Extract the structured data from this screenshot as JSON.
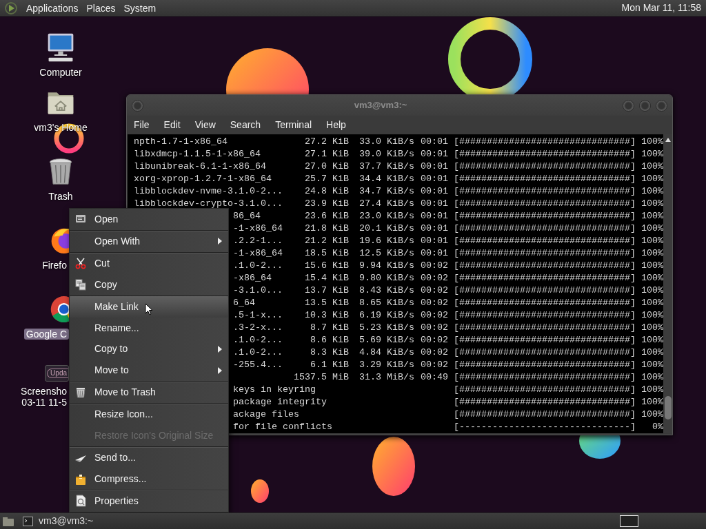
{
  "top_panel": {
    "menus": [
      "Applications",
      "Places",
      "System"
    ],
    "clock": "Mon Mar 11, 11:58"
  },
  "desktop_icons": [
    {
      "kind": "computer",
      "lines": [
        "Computer"
      ],
      "selected": false,
      "covered": false
    },
    {
      "kind": "home",
      "lines": [
        "vm3's Home"
      ],
      "selected": false,
      "covered": false
    },
    {
      "kind": "trash",
      "lines": [
        "Trash"
      ],
      "selected": false,
      "covered": false
    },
    {
      "kind": "firefox",
      "lines": [
        "Firefo"
      ],
      "selected": false,
      "covered": true
    },
    {
      "kind": "chrome",
      "lines": [
        "Google C"
      ],
      "selected": true,
      "covered": true
    },
    {
      "kind": "thumbnail",
      "thumb_text": "Upda",
      "lines": [
        "Screensho",
        "03-11 11-5"
      ],
      "selected": false,
      "covered": true
    }
  ],
  "terminal": {
    "title": "vm3@vm3:~",
    "menus": [
      "File",
      "Edit",
      "View",
      "Search",
      "Terminal",
      "Help"
    ],
    "rows": [
      {
        "name": "npth-1.7-1-x86_64",
        "covered": false,
        "size": "27.2 KiB",
        "speed": "33.0 KiB/s",
        "time": "00:01",
        "bar": "[###############################]",
        "percent": "100%"
      },
      {
        "name": "libxdmcp-1.1.5-1-x86_64",
        "covered": false,
        "size": "27.1 KiB",
        "speed": "39.0 KiB/s",
        "time": "00:01",
        "bar": "[###############################]",
        "percent": "100%"
      },
      {
        "name": "libunibreak-6.1-1-x86_64",
        "covered": false,
        "size": "27.0 KiB",
        "speed": "37.7 KiB/s",
        "time": "00:01",
        "bar": "[###############################]",
        "percent": "100%"
      },
      {
        "name": "xorg-xprop-1.2.7-1-x86_64",
        "covered": false,
        "size": "25.7 KiB",
        "speed": "34.4 KiB/s",
        "time": "00:01",
        "bar": "[###############################]",
        "percent": "100%"
      },
      {
        "name": "libblockdev-nvme-3.1.0-2...",
        "covered": false,
        "size": "24.8 KiB",
        "speed": "34.7 KiB/s",
        "time": "00:01",
        "bar": "[###############################]",
        "percent": "100%"
      },
      {
        "name": "libblockdev-crypto-3.1.0...",
        "covered": false,
        "size": "23.9 KiB",
        "speed": "27.4 KiB/s",
        "time": "00:01",
        "bar": "[###############################]",
        "percent": "100%"
      },
      {
        "name": "86_64",
        "covered": true,
        "size": "23.6 KiB",
        "speed": "23.0 KiB/s",
        "time": "00:01",
        "bar": "[###############################]",
        "percent": "100%"
      },
      {
        "name": "-1-x86_64",
        "covered": true,
        "size": "21.8 KiB",
        "speed": "20.1 KiB/s",
        "time": "00:01",
        "bar": "[###############################]",
        "percent": "100%"
      },
      {
        "name": ".2.2-1...",
        "covered": true,
        "size": "21.2 KiB",
        "speed": "19.6 KiB/s",
        "time": "00:01",
        "bar": "[###############################]",
        "percent": "100%"
      },
      {
        "name": "-1-x86_64",
        "covered": true,
        "size": "18.5 KiB",
        "speed": "12.5 KiB/s",
        "time": "00:01",
        "bar": "[###############################]",
        "percent": "100%"
      },
      {
        "name": ".1.0-2...",
        "covered": true,
        "size": "15.6 KiB",
        "speed": "9.94 KiB/s",
        "time": "00:02",
        "bar": "[###############################]",
        "percent": "100%"
      },
      {
        "name": "-x86_64",
        "covered": true,
        "size": "15.4 KiB",
        "speed": "9.80 KiB/s",
        "time": "00:02",
        "bar": "[###############################]",
        "percent": "100%"
      },
      {
        "name": "-3.1.0...",
        "covered": true,
        "size": "13.7 KiB",
        "speed": "8.43 KiB/s",
        "time": "00:02",
        "bar": "[###############################]",
        "percent": "100%"
      },
      {
        "name": "6_64",
        "covered": true,
        "size": "13.5 KiB",
        "speed": "8.65 KiB/s",
        "time": "00:02",
        "bar": "[###############################]",
        "percent": "100%"
      },
      {
        "name": ".5-1-x...",
        "covered": true,
        "size": "10.3 KiB",
        "speed": "6.19 KiB/s",
        "time": "00:02",
        "bar": "[###############################]",
        "percent": "100%"
      },
      {
        "name": ".3-2-x...",
        "covered": true,
        "size": "8.7 KiB",
        "speed": "5.23 KiB/s",
        "time": "00:02",
        "bar": "[###############################]",
        "percent": "100%"
      },
      {
        "name": ".1.0-2...",
        "covered": true,
        "size": "8.6 KiB",
        "speed": "5.69 KiB/s",
        "time": "00:02",
        "bar": "[###############################]",
        "percent": "100%"
      },
      {
        "name": ".1.0-2...",
        "covered": true,
        "size": "8.3 KiB",
        "speed": "4.84 KiB/s",
        "time": "00:02",
        "bar": "[###############################]",
        "percent": "100%"
      },
      {
        "name": "-255.4...",
        "covered": true,
        "size": "6.1 KiB",
        "speed": "3.29 KiB/s",
        "time": "00:02",
        "bar": "[###############################]",
        "percent": "100%"
      },
      {
        "size": "1537.5 MiB",
        "speed": "31.3 MiB/s",
        "time": "00:49",
        "bar": "[###############################]",
        "percent": "100%"
      },
      {
        "name": "keys in keyring",
        "covered": true,
        "bar": "[###############################]",
        "percent": "100%"
      },
      {
        "name": "package integrity",
        "covered": true,
        "bar": "[###############################]",
        "percent": "100%"
      },
      {
        "name": "ackage files",
        "covered": true,
        "bar": "[###############################]",
        "percent": "100%"
      },
      {
        "name": "for file conflicts",
        "covered": true,
        "bar": "[-------------------------------]",
        "percent": "0%"
      }
    ]
  },
  "context_menu": [
    {
      "label": "Open",
      "kind": "open",
      "submenu": false,
      "disabled": false,
      "selected": false,
      "divider_after": true
    },
    {
      "label": "Open With",
      "submenu": true,
      "disabled": false,
      "selected": false,
      "divider_after": true
    },
    {
      "label": "Cut",
      "kind": "cut",
      "submenu": false,
      "disabled": false,
      "selected": false,
      "divider_after": false
    },
    {
      "label": "Copy",
      "kind": "copy",
      "submenu": false,
      "disabled": false,
      "selected": false,
      "divider_after": true
    },
    {
      "label": "Make Link",
      "submenu": false,
      "disabled": false,
      "selected": true,
      "divider_after": false
    },
    {
      "label": "Rename...",
      "submenu": false,
      "disabled": false,
      "selected": false,
      "divider_after": false
    },
    {
      "label": "Copy to",
      "submenu": true,
      "disabled": false,
      "selected": false,
      "divider_after": false
    },
    {
      "label": "Move to",
      "submenu": true,
      "disabled": false,
      "selected": false,
      "divider_after": true
    },
    {
      "label": "Move to Trash",
      "kind": "trash",
      "submenu": false,
      "disabled": false,
      "selected": false,
      "divider_after": true
    },
    {
      "label": "Resize Icon...",
      "submenu": false,
      "disabled": false,
      "selected": false,
      "divider_after": false
    },
    {
      "label": "Restore Icon's Original Size",
      "submenu": false,
      "disabled": true,
      "selected": false,
      "divider_after": true
    },
    {
      "label": "Send to...",
      "kind": "send",
      "submenu": false,
      "disabled": false,
      "selected": false,
      "divider_after": false
    },
    {
      "label": "Compress...",
      "kind": "compress",
      "submenu": false,
      "disabled": false,
      "selected": false,
      "divider_after": true
    },
    {
      "label": "Properties",
      "kind": "properties",
      "submenu": false,
      "disabled": false,
      "selected": false,
      "divider_after": false
    }
  ],
  "bottom_panel": {
    "task": "vm3@vm3:~"
  }
}
